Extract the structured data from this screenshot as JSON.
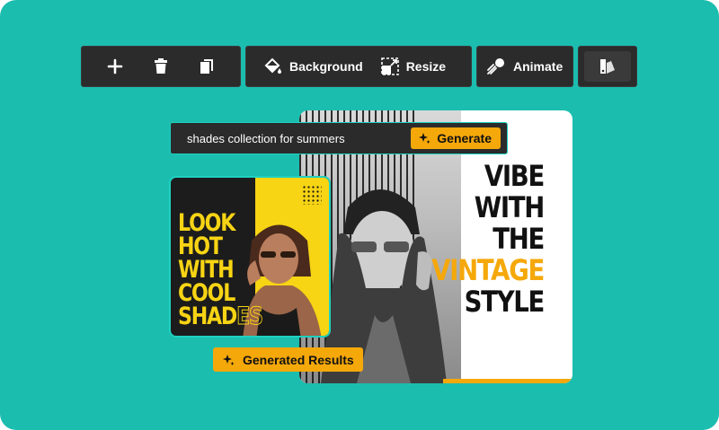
{
  "toolbar": {
    "add_icon": "plus-icon",
    "delete_icon": "trash-icon",
    "duplicate_icon": "copy-icon",
    "background_label": "Background",
    "resize_label": "Resize",
    "animate_label": "Animate",
    "style_icon": "palette-icon"
  },
  "prompt": {
    "text": "shades collection for summers",
    "generate_label": "Generate"
  },
  "design": {
    "headline": [
      "VIBE",
      "WITH THE",
      "VINTAGE",
      "STYLE"
    ],
    "accent_color": "#f5a80a"
  },
  "result": {
    "headline_lines": [
      "LOOK",
      "HOT",
      "WITH",
      "COOL"
    ],
    "last_word_part1": "SHAD",
    "last_word_part2": "ES",
    "badge_label": "Generated Results"
  },
  "colors": {
    "background": "#1bbdaf",
    "toolbar": "#2b2b2b",
    "accent": "#f5a80a",
    "result_yellow": "#f7d414"
  }
}
